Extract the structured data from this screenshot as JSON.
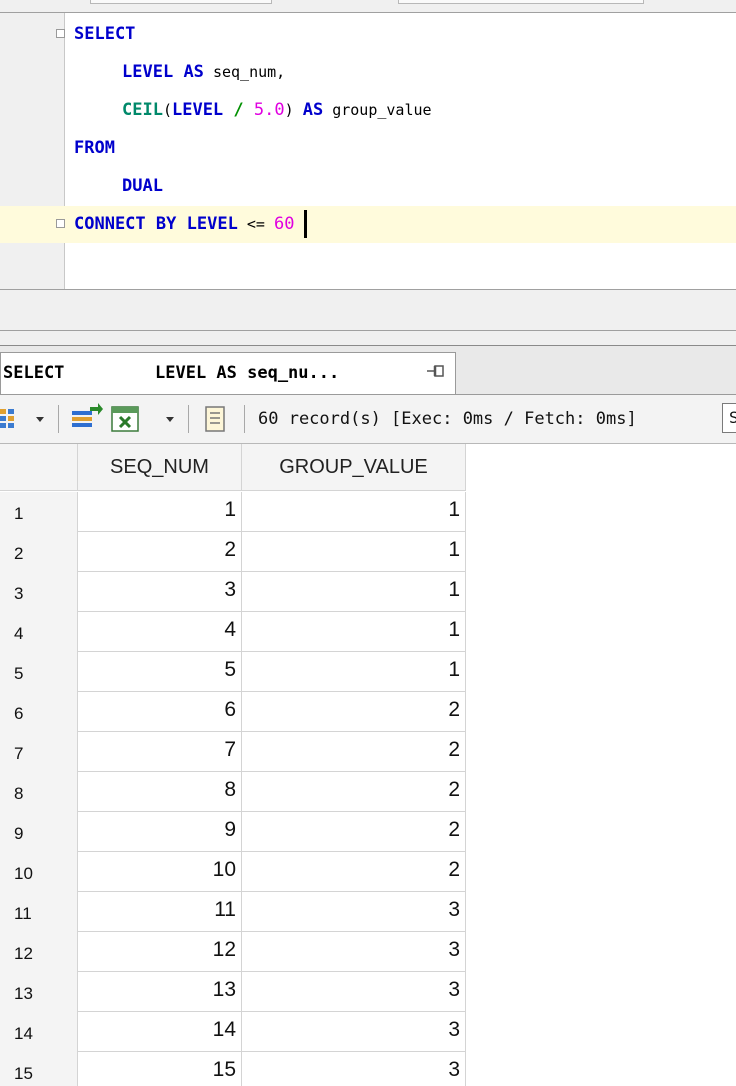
{
  "editor": {
    "lines": [
      {
        "tokens": [
          {
            "t": "SELECT",
            "c": "kw-b"
          }
        ]
      },
      {
        "tokens": [
          {
            "t": "LEVEL",
            "c": "kw-b"
          },
          {
            "t": " ",
            "c": ""
          },
          {
            "t": "AS",
            "c": "kw-b"
          },
          {
            "t": " seq_num,",
            "c": "plain"
          }
        ]
      },
      {
        "tokens": [
          {
            "t": "CEIL",
            "c": "kw-g"
          },
          {
            "t": "(",
            "c": "plain"
          },
          {
            "t": "LEVEL",
            "c": "kw-b"
          },
          {
            "t": " ",
            "c": ""
          },
          {
            "t": "/",
            "c": "op"
          },
          {
            "t": " ",
            "c": ""
          },
          {
            "t": "5.0",
            "c": "num"
          },
          {
            "t": ") ",
            "c": "plain"
          },
          {
            "t": "AS",
            "c": "kw-b"
          },
          {
            "t": " group_value",
            "c": "plain"
          }
        ]
      },
      {
        "tokens": [
          {
            "t": "FROM",
            "c": "kw-b"
          }
        ]
      },
      {
        "tokens": [
          {
            "t": "DUAL",
            "c": "kw-b"
          }
        ]
      },
      {
        "tokens": [
          {
            "t": "CONNECT",
            "c": "kw-b"
          },
          {
            "t": " ",
            "c": ""
          },
          {
            "t": "BY",
            "c": "kw-b"
          },
          {
            "t": " ",
            "c": ""
          },
          {
            "t": "LEVEL",
            "c": "kw-b"
          },
          {
            "t": " <= ",
            "c": "plain"
          },
          {
            "t": "60",
            "c": "num"
          }
        ]
      }
    ]
  },
  "result_tab": {
    "label_part1": "SELECT",
    "label_part2": "LEVEL AS seq_nu..."
  },
  "toolbar": {
    "status": "60 record(s) [Exec: 0ms / Fetch: 0ms]",
    "overflow_text": "S"
  },
  "grid": {
    "columns": [
      "SEQ_NUM",
      "GROUP_VALUE"
    ],
    "rows": [
      {
        "n": "1",
        "seq": "1",
        "grp": "1"
      },
      {
        "n": "2",
        "seq": "2",
        "grp": "1"
      },
      {
        "n": "3",
        "seq": "3",
        "grp": "1"
      },
      {
        "n": "4",
        "seq": "4",
        "grp": "1"
      },
      {
        "n": "5",
        "seq": "5",
        "grp": "1"
      },
      {
        "n": "6",
        "seq": "6",
        "grp": "2"
      },
      {
        "n": "7",
        "seq": "7",
        "grp": "2"
      },
      {
        "n": "8",
        "seq": "8",
        "grp": "2"
      },
      {
        "n": "9",
        "seq": "9",
        "grp": "2"
      },
      {
        "n": "10",
        "seq": "10",
        "grp": "2"
      },
      {
        "n": "11",
        "seq": "11",
        "grp": "3"
      },
      {
        "n": "12",
        "seq": "12",
        "grp": "3"
      },
      {
        "n": "13",
        "seq": "13",
        "grp": "3"
      },
      {
        "n": "14",
        "seq": "14",
        "grp": "3"
      },
      {
        "n": "15",
        "seq": "15",
        "grp": "3"
      }
    ]
  },
  "colors": {
    "keyword": "#0000cc",
    "function": "#00896a",
    "number": "#e000e0",
    "operator": "#009000",
    "current_line": "#fffbdc"
  },
  "icons": [
    "fold-toggle-icon",
    "pin-icon",
    "grid-options-icon",
    "dropdown-arrow-icon",
    "export-icon",
    "excel-icon",
    "script-icon"
  ]
}
